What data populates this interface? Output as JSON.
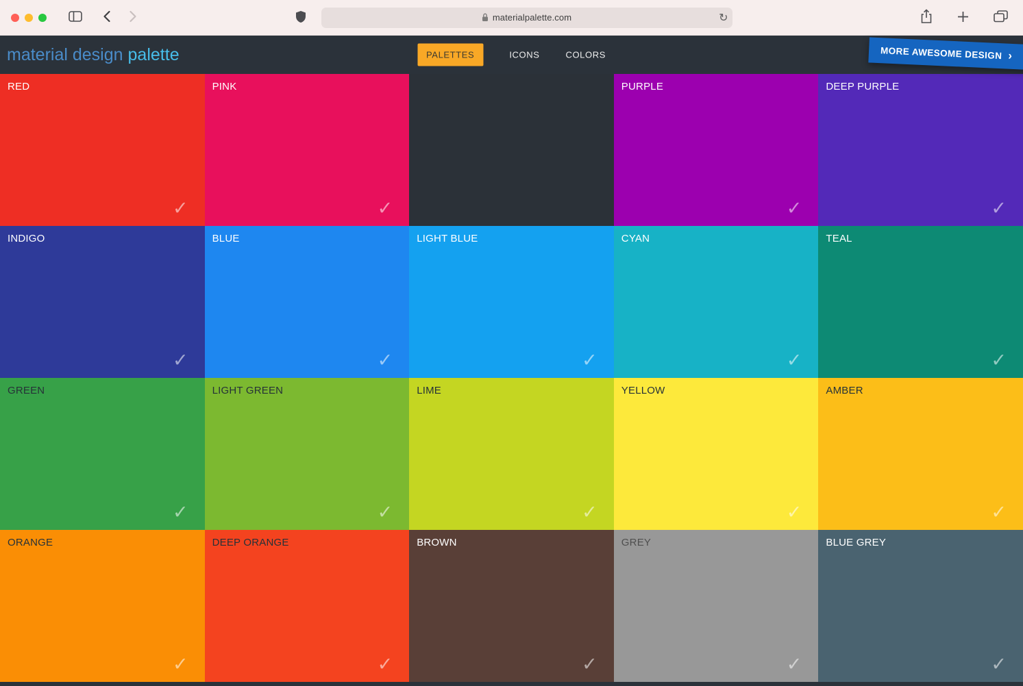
{
  "browser": {
    "url": "materialpalette.com",
    "refresh_glyph": "↻",
    "traffic_lights": {
      "close": "#ff5f57",
      "minimize": "#febc2e",
      "zoom": "#28c840"
    }
  },
  "header": {
    "logo_part1": "material design",
    "logo_part2": "palette",
    "nav": [
      {
        "label": "PALETTES",
        "active": true
      },
      {
        "label": "ICONS",
        "active": false
      },
      {
        "label": "COLORS",
        "active": false
      }
    ],
    "ribbon": {
      "label": "MORE AWESOME DESIGN",
      "chevron": "›"
    }
  },
  "colors": {
    "chrome-bg": "#f7eeed",
    "urlbar-bg": "#e7dedd",
    "header-bg": "#2b323a",
    "logo-blue": "#4a8cc9",
    "logo-cyan": "#47bde9",
    "nav-active-bg": "#f9a826",
    "ribbon-blue": "#1565c0"
  },
  "palette": {
    "check_glyph": "✓",
    "tiles": [
      {
        "name": "RED",
        "color": "#ee2e24",
        "text": "#ffffff",
        "check": true
      },
      {
        "name": "PINK",
        "color": "#e8105c",
        "text": "#ffffff",
        "check": true
      },
      {
        "name": "",
        "color": "#2b3138",
        "text": "#ffffff",
        "check": false
      },
      {
        "name": "PURPLE",
        "color": "#9c00af",
        "text": "#ffffff",
        "check": true
      },
      {
        "name": "DEEP PURPLE",
        "color": "#5329b8",
        "text": "#ffffff",
        "check": true
      },
      {
        "name": "INDIGO",
        "color": "#2e3a99",
        "text": "#ffffff",
        "check": true
      },
      {
        "name": "BLUE",
        "color": "#1e87f0",
        "text": "#ffffff",
        "check": true
      },
      {
        "name": "LIGHT BLUE",
        "color": "#14a1f0",
        "text": "#ffffff",
        "check": true
      },
      {
        "name": "CYAN",
        "color": "#17b2c6",
        "text": "#ffffff",
        "check": true
      },
      {
        "name": "TEAL",
        "color": "#0d8a74",
        "text": "#ffffff",
        "check": true
      },
      {
        "name": "GREEN",
        "color": "#37a148",
        "text": "#263238",
        "check": true
      },
      {
        "name": "LIGHT GREEN",
        "color": "#7cb930",
        "text": "#263238",
        "check": true
      },
      {
        "name": "LIME",
        "color": "#c4d622",
        "text": "#263238",
        "check": true
      },
      {
        "name": "YELLOW",
        "color": "#fde93b",
        "text": "#263238",
        "check": true
      },
      {
        "name": "AMBER",
        "color": "#fcbe18",
        "text": "#263238",
        "check": true
      },
      {
        "name": "ORANGE",
        "color": "#fa8e05",
        "text": "#263238",
        "check": true
      },
      {
        "name": "DEEP ORANGE",
        "color": "#f4431f",
        "text": "#263238",
        "check": true
      },
      {
        "name": "BROWN",
        "color": "#593f37",
        "text": "#ffffff",
        "check": true
      },
      {
        "name": "GREY",
        "color": "#989898",
        "text": "#4f4f4f",
        "check": true
      },
      {
        "name": "BLUE GREY",
        "color": "#4a6370",
        "text": "#ffffff",
        "check": true
      }
    ]
  }
}
